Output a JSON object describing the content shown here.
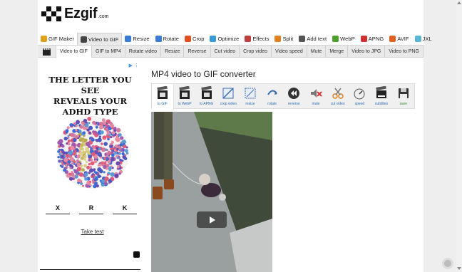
{
  "logo": {
    "name": "Ezgif",
    "suffix": ".com"
  },
  "main_nav": [
    {
      "label": "GIF Maker",
      "color": "#e0a020"
    },
    {
      "label": "Video to GIF",
      "color": "#444444",
      "active": true
    },
    {
      "label": "Resize",
      "color": "#3a7bd5"
    },
    {
      "label": "Rotate",
      "color": "#3a7bd5"
    },
    {
      "label": "Crop",
      "color": "#e05020"
    },
    {
      "label": "Optimize",
      "color": "#3a9ad5"
    },
    {
      "label": "Effects",
      "color": "#c04040"
    },
    {
      "label": "Split",
      "color": "#e08020"
    },
    {
      "label": "Add text",
      "color": "#555555"
    },
    {
      "label": "WebP",
      "color": "#50a030"
    },
    {
      "label": "APNG",
      "color": "#d03030"
    },
    {
      "label": "AVIF",
      "color": "#e06020"
    },
    {
      "label": "JXL",
      "color": "#5bb5d5"
    }
  ],
  "sub_nav": [
    "Video to GIF",
    "GIF to MP4",
    "Rotate video",
    "Resize",
    "Reverse",
    "Cut video",
    "Crop video",
    "Video speed",
    "Mute",
    "Merge",
    "Video to JPG",
    "Video to PNG"
  ],
  "page_title": "MP4 video to GIF converter",
  "tools": [
    {
      "label": "to GIF",
      "icon": "film-icon"
    },
    {
      "label": "to WebP",
      "icon": "film-icon"
    },
    {
      "label": "to APNG",
      "icon": "film-icon"
    },
    {
      "label": "crop video",
      "icon": "crop-icon"
    },
    {
      "label": "resize",
      "icon": "resize-icon"
    },
    {
      "label": "rotate",
      "icon": "rotate-icon"
    },
    {
      "label": "reverse",
      "icon": "reverse-icon"
    },
    {
      "label": "mute",
      "icon": "mute-icon"
    },
    {
      "label": "cut video",
      "icon": "scissors-icon"
    },
    {
      "label": "speed",
      "icon": "speed-icon"
    },
    {
      "label": "subtitles",
      "icon": "subtitles-icon"
    },
    {
      "label": "save",
      "icon": "save-icon"
    }
  ],
  "ad": {
    "badge": "ad-choices-icon",
    "headline": [
      "THE LETTER YOU SEE",
      "REVEALS YOUR",
      "ADHD TYPE"
    ],
    "options": [
      "X",
      "R",
      "K"
    ],
    "link": "Take test",
    "plate_letter": "K"
  }
}
